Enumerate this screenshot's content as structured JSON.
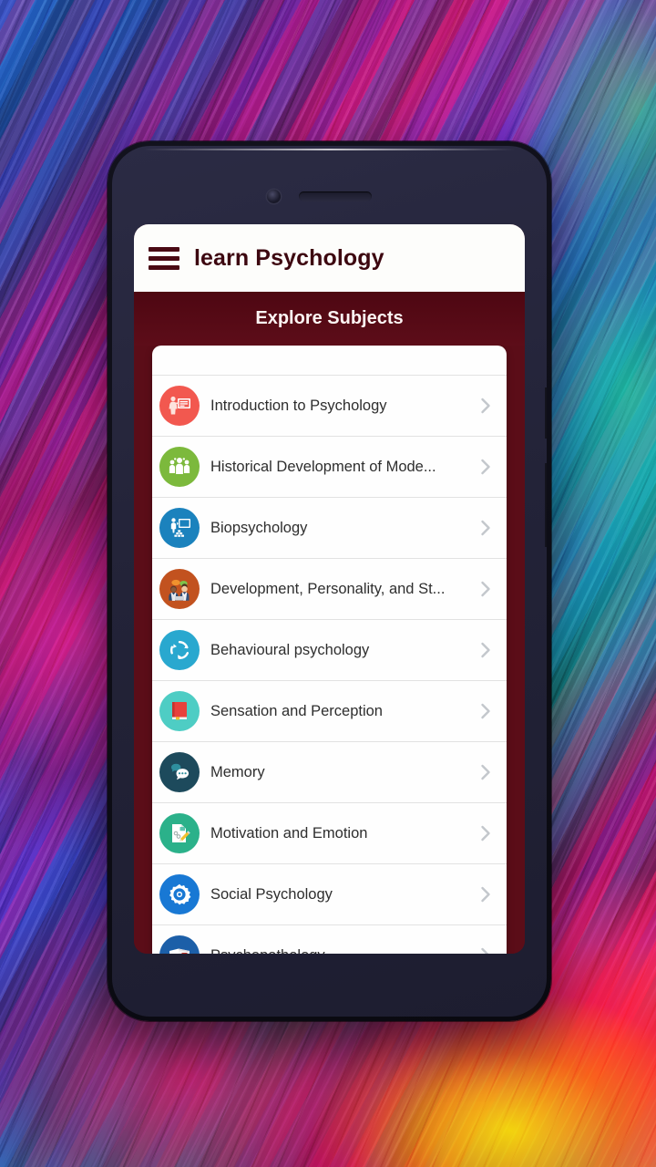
{
  "app": {
    "title": "learn Psychology",
    "menu_icon": "hamburger-menu-icon",
    "section_title": "Explore Subjects"
  },
  "colors": {
    "header_maroon": "#5b0d18",
    "appbar_background": "#fdfdfb",
    "title_text": "#3d0710",
    "card_background": "#fefefe",
    "row_divider": "#e2e2e2",
    "chevron": "#c3c7cc",
    "device_bezel": "#252540"
  },
  "subjects": [
    {
      "label": "Introduction to Psychology",
      "icon": "teacher-whiteboard-icon",
      "icon_color": "#f2584f",
      "chevron": "chevron-right-icon"
    },
    {
      "label": "Historical Development of Mode...",
      "icon": "people-group-icon",
      "icon_color": "#7cb93c",
      "chevron": "chevron-right-icon"
    },
    {
      "label": "Biopsychology",
      "icon": "presentation-chart-icon",
      "icon_color": "#1b82bd",
      "chevron": "chevron-right-icon"
    },
    {
      "label": "Development, Personality, and St...",
      "icon": "two-people-chat-icon",
      "icon_color": "#c2521f",
      "chevron": "chevron-right-icon"
    },
    {
      "label": "Behavioural psychology",
      "icon": "cycle-arrows-icon",
      "icon_color": "#29a8cf",
      "chevron": "chevron-right-icon"
    },
    {
      "label": "Sensation and Perception",
      "icon": "red-book-icon",
      "icon_color": "#4ecdc4",
      "chevron": "chevron-right-icon"
    },
    {
      "label": "Memory",
      "icon": "speech-bubbles-icon",
      "icon_color": "#1d4a5c",
      "chevron": "chevron-right-icon"
    },
    {
      "label": "Motivation and Emotion",
      "icon": "document-pencil-icon",
      "icon_color": "#2bb18a",
      "chevron": "chevron-right-icon"
    },
    {
      "label": "Social Psychology",
      "icon": "gear-icon",
      "icon_color": "#1878d4",
      "chevron": "chevron-right-icon"
    },
    {
      "label": "Psychopathology",
      "icon": "notebook-pencil-icon",
      "icon_color": "#1c5fa8",
      "chevron": "chevron-right-icon"
    }
  ],
  "device": {
    "camera": "front-camera-icon",
    "speaker": "earpiece-speaker",
    "buttons": [
      "volume-button",
      "power-button"
    ]
  }
}
